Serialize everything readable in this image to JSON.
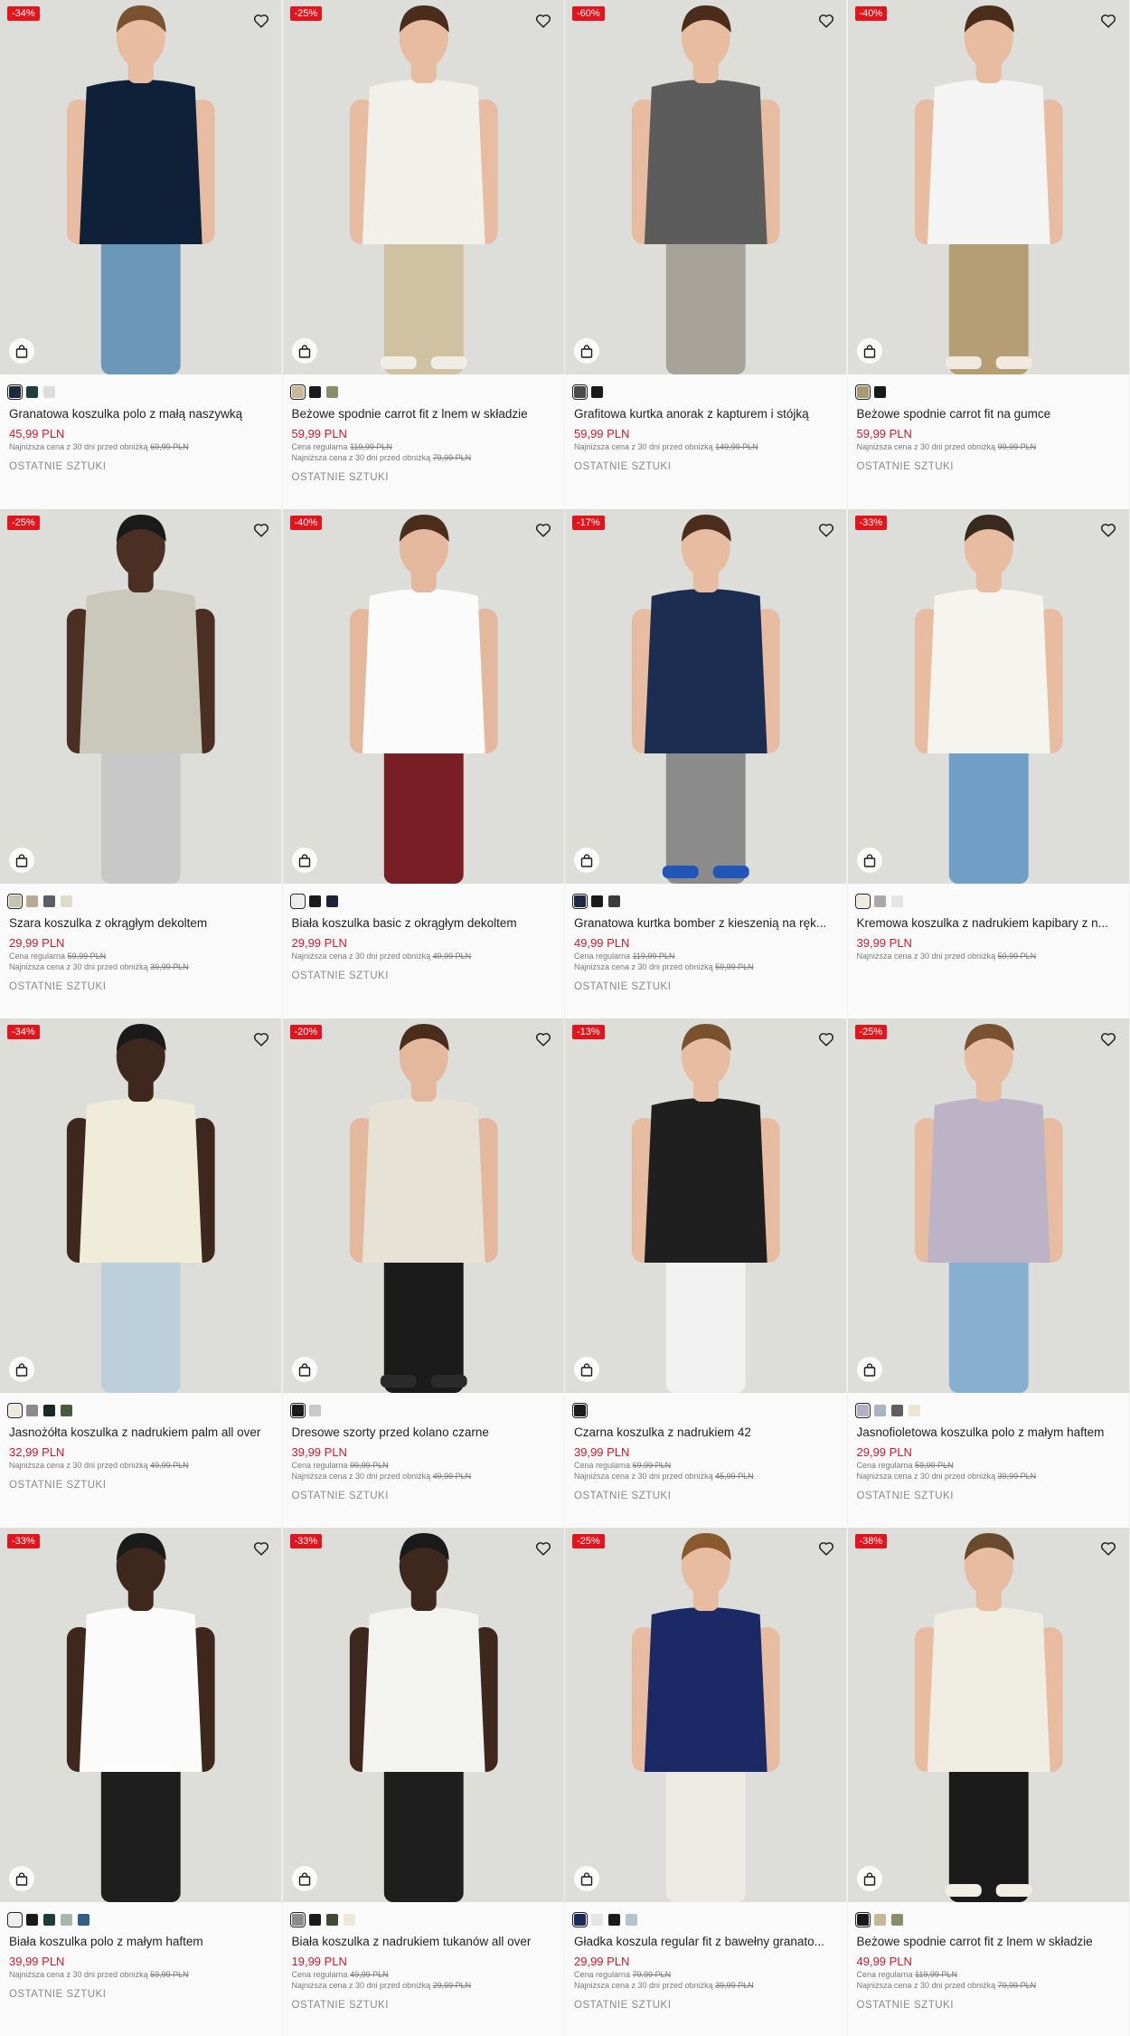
{
  "colors": {
    "sale": "#e3141c",
    "price": "#d3182b",
    "muted": "#7a7a7a"
  },
  "icons": {
    "wishlist": "heart-icon",
    "cart": "shopping-bag-icon"
  },
  "products": [
    {
      "discount": "-34%",
      "name": "Granatowa koszulka polo z małą naszywką",
      "price": "45,99 PLN",
      "regular": "",
      "regular_label": "",
      "lowest": "69,99 PLN",
      "lowest_label": "Najniższa cena z 30 dni przed obniżką",
      "tag": "OSTATNIE SZTUKI",
      "swatches": [
        "#1c2a3a",
        "#1f3d3b",
        "#dcdcdc"
      ],
      "top": "#0f2138",
      "bottom": "#6b98b8",
      "skin": "#e7bca0",
      "hair": "#7a5230",
      "shoe": null
    },
    {
      "discount": "-25%",
      "name": "Beżowe spodnie carrot fit z lnem w składzie",
      "price": "59,99 PLN",
      "regular": "119,99 PLN",
      "regular_label": "Cena regularna",
      "lowest": "79,99 PLN",
      "lowest_label": "Najniższa cena z 30 dni przed obniżką",
      "tag": "OSTATNIE SZTUKI",
      "swatches": [
        "#c9b89a",
        "#1a1a1a",
        "#8a8d6c"
      ],
      "top": "#f2f0ea",
      "bottom": "#cfc1a2",
      "skin": "#e7bca0",
      "hair": "#4a2e1b",
      "shoe": "#f0ede6"
    },
    {
      "discount": "-60%",
      "name": "Grafitowa kurtka anorak z kapturem i stójką",
      "price": "59,99 PLN",
      "regular": "",
      "regular_label": "",
      "lowest": "149,99 PLN",
      "lowest_label": "Najniższa cena z 30 dni przed obniżką",
      "tag": "OSTATNIE SZTUKI",
      "swatches": [
        "#4a4a4a",
        "#1a1a1a"
      ],
      "top": "#5c5c5c",
      "bottom": "#a8a39a",
      "skin": "#e7bca0",
      "hair": "#4a2e1b",
      "shoe": null
    },
    {
      "discount": "-40%",
      "name": "Beżowe spodnie carrot fit na gumce",
      "price": "59,99 PLN",
      "regular": "",
      "regular_label": "",
      "lowest": "99,99 PLN",
      "lowest_label": "Najniższa cena z 30 dni przed obniżką",
      "tag": "OSTATNIE SZTUKI",
      "swatches": [
        "#a89b74",
        "#1a1a1a"
      ],
      "top": "#f4f4f4",
      "bottom": "#b59e74",
      "skin": "#e7bca0",
      "hair": "#4a2e1b",
      "shoe": "#efe9df"
    },
    {
      "discount": "-25%",
      "name": "Szara koszulka z okrągłym dekoltem",
      "price": "29,99 PLN",
      "regular": "59,99 PLN",
      "regular_label": "Cena regularna",
      "lowest": "39,99 PLN",
      "lowest_label": "Najniższa cena z 30 dni przed obniżką",
      "tag": "OSTATNIE SZTUKI",
      "swatches": [
        "#c3c3b0",
        "#b7a993",
        "#5a5f66",
        "#dcdccc"
      ],
      "top": "#c9c8bb",
      "bottom": "#c8c8c8",
      "skin": "#4b2f22",
      "hair": "#1a1a1a",
      "shoe": null
    },
    {
      "discount": "-40%",
      "name": "Biała koszulka basic z okrągłym dekoltem",
      "price": "29,99 PLN",
      "regular": "",
      "regular_label": "",
      "lowest": "49,99 PLN",
      "lowest_label": "Najniższa cena z 30 dni przed obniżką",
      "tag": "OSTATNIE SZTUKI",
      "swatches": [
        "#ececec",
        "#1a1a1a",
        "#1b2535"
      ],
      "top": "#fbfbfb",
      "bottom": "#7a1e26",
      "skin": "#e3b89c",
      "hair": "#4a2e1b",
      "shoe": null
    },
    {
      "discount": "-17%",
      "name": "Granatowa kurtka bomber z kieszenią na ręk...",
      "price": "49,99 PLN",
      "regular": "119,99 PLN",
      "regular_label": "Cena regularna",
      "lowest": "59,99 PLN",
      "lowest_label": "Najniższa cena z 30 dni przed obniżką",
      "tag": "OSTATNIE SZTUKI",
      "swatches": [
        "#1c2a44",
        "#1a1a1a",
        "#3c3c3c"
      ],
      "top": "#1c2d52",
      "bottom": "#8b8b8b",
      "skin": "#e7bca0",
      "hair": "#4a2e1b",
      "shoe": "#1f56b7"
    },
    {
      "discount": "-33%",
      "name": "Kremowa koszulka z nadrukiem kapibary z n...",
      "price": "39,99 PLN",
      "regular": "",
      "regular_label": "",
      "lowest": "59,99 PLN",
      "lowest_label": "Najniższa cena z 30 dni przed obniżką",
      "tag": "",
      "swatches": [
        "#efeae0",
        "#a9a9a9",
        "#e4e4e4"
      ],
      "top": "#f6f4ef",
      "bottom": "#6f9fc6",
      "skin": "#e7bca0",
      "hair": "#3a2a1e",
      "shoe": null
    },
    {
      "discount": "-34%",
      "name": "Jasnożółta koszulka z nadrukiem palm all over",
      "price": "32,99 PLN",
      "regular": "",
      "regular_label": "",
      "lowest": "49,99 PLN",
      "lowest_label": "Najniższa cena z 30 dni przed obniżką",
      "tag": "OSTATNIE SZTUKI",
      "swatches": [
        "#ecead8",
        "#8a8a8a",
        "#1a2a22",
        "#4a5a3a"
      ],
      "top": "#efedd9",
      "bottom": "#bcd0db",
      "skin": "#3e271c",
      "hair": "#1a1a1a",
      "shoe": null
    },
    {
      "discount": "-20%",
      "name": "Dresowe szorty przed kolano czarne",
      "price": "39,99 PLN",
      "regular": "99,99 PLN",
      "regular_label": "Cena regularna",
      "lowest": "49,99 PLN",
      "lowest_label": "Najniższa cena z 30 dni przed obniżką",
      "tag": "OSTATNIE SZTUKI",
      "swatches": [
        "#1a1a1a",
        "#c9c9c9"
      ],
      "top": "#e6e2d6",
      "bottom": "#1b1b1b",
      "skin": "#e3b89c",
      "hair": "#4a2e1b",
      "shoe": "#2b2b2b"
    },
    {
      "discount": "-13%",
      "name": "Czarna koszulka z nadrukiem 42",
      "price": "39,99 PLN",
      "regular": "69,99 PLN",
      "regular_label": "Cena regularna",
      "lowest": "45,99 PLN",
      "lowest_label": "Najniższa cena z 30 dni przed obniżką",
      "tag": "OSTATNIE SZTUKI",
      "swatches": [
        "#1a1a1a"
      ],
      "top": "#1f1f1f",
      "bottom": "#f2f2f2",
      "skin": "#e7bca0",
      "hair": "#7a5230",
      "shoe": null
    },
    {
      "discount": "-25%",
      "name": "Jasnofioletowa koszulka polo z małym haftem",
      "price": "29,99 PLN",
      "regular": "59,99 PLN",
      "regular_label": "Cena regularna",
      "lowest": "39,99 PLN",
      "lowest_label": "Najniższa cena z 30 dni przed obniżką",
      "tag": "OSTATNIE SZTUKI",
      "swatches": [
        "#b6aec3",
        "#a9b4c2",
        "#5f5f5f",
        "#ede6cf"
      ],
      "top": "#bdb3c7",
      "bottom": "#86afd0",
      "skin": "#e7bca0",
      "hair": "#7a5230",
      "shoe": null
    },
    {
      "discount": "-33%",
      "name": "Biała koszulka polo z małym haftem",
      "price": "39,99 PLN",
      "regular": "",
      "regular_label": "",
      "lowest": "59,99 PLN",
      "lowest_label": "Najniższa cena z 30 dni przed obniżką",
      "tag": "OSTATNIE SZTUKI",
      "swatches": [
        "#eeeeee",
        "#1a1a1a",
        "#1f3a3a",
        "#a9b6b0",
        "#2f5f8a"
      ],
      "top": "#fbfbfb",
      "bottom": "#1e1e1e",
      "skin": "#3e271c",
      "hair": "#1a1a1a",
      "shoe": null
    },
    {
      "discount": "-33%",
      "name": "Biała koszulka z nadrukiem tukanów all over",
      "price": "19,99 PLN",
      "regular": "49,99 PLN",
      "regular_label": "Cena regularna",
      "lowest": "29,99 PLN",
      "lowest_label": "Najniższa cena z 30 dni przed obniżką",
      "tag": "OSTATNIE SZTUKI",
      "swatches": [
        "#8b8b8b",
        "#1a1a1a",
        "#3f4a36",
        "#ede9d6"
      ],
      "top": "#f3f3f1",
      "bottom": "#1e1e1e",
      "skin": "#3e271c",
      "hair": "#1a1a1a",
      "shoe": null
    },
    {
      "discount": "-25%",
      "name": "Gładka koszula regular fit z bawełny granato...",
      "price": "29,99 PLN",
      "regular": "79,99 PLN",
      "regular_label": "Cena regularna",
      "lowest": "39,99 PLN",
      "lowest_label": "Najniższa cena z 30 dni przed obniżką",
      "tag": "OSTATNIE SZTUKI",
      "swatches": [
        "#1b2a5a",
        "#e6e6e6",
        "#1a1a1a",
        "#b6c3cc"
      ],
      "top": "#1b2a66",
      "bottom": "#eceae2",
      "skin": "#e7bca0",
      "hair": "#8a5a2e",
      "shoe": null
    },
    {
      "discount": "-38%",
      "name": "Beżowe spodnie carrot fit z lnem w składzie",
      "price": "49,99 PLN",
      "regular": "119,99 PLN",
      "regular_label": "Cena regularna",
      "lowest": "79,99 PLN",
      "lowest_label": "Najniższa cena z 30 dni przed obniżką",
      "tag": "OSTATNIE SZTUKI",
      "swatches": [
        "#1a1a1a",
        "#c6b896",
        "#8a8d6c"
      ],
      "top": "#efede2",
      "bottom": "#1a1a1a",
      "skin": "#e7bca0",
      "hair": "#6a4a2e",
      "shoe": "#f1eee6"
    }
  ]
}
